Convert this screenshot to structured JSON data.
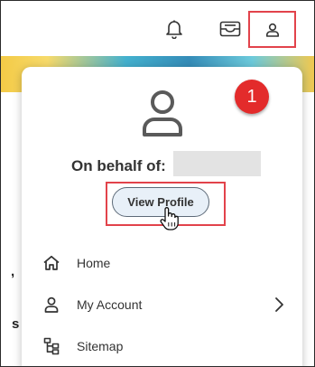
{
  "header": {
    "icons": {
      "notifications": "bell-icon",
      "inbox": "inbox-icon",
      "profile": "user-icon"
    }
  },
  "background": {
    "fragments": [
      ",",
      "s"
    ]
  },
  "popup": {
    "badge_number": "1",
    "on_behalf_label": "On behalf of:",
    "view_profile_label": "View Profile",
    "menu": [
      {
        "label": "Home",
        "icon": "home-icon"
      },
      {
        "label": "My Account",
        "icon": "user-icon",
        "has_submenu": true
      },
      {
        "label": "Sitemap",
        "icon": "sitemap-icon"
      }
    ]
  },
  "colors": {
    "highlight": "#e2434b",
    "badge": "#e32b2b",
    "button_bg": "#e8f0f8",
    "text": "#333333"
  }
}
